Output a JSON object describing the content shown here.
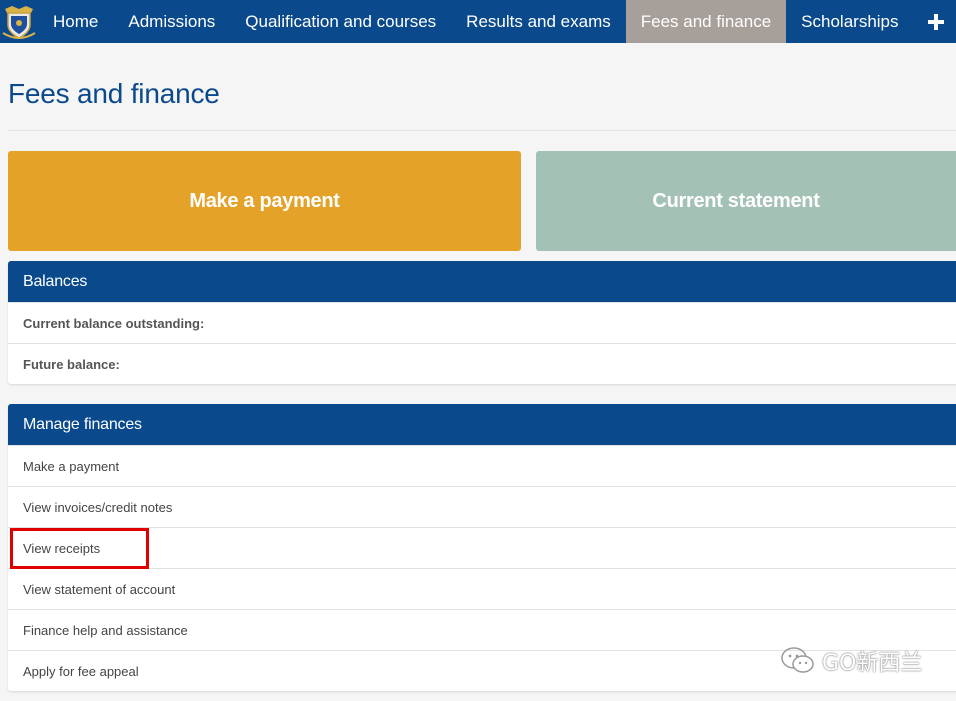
{
  "nav": {
    "items": [
      {
        "label": "Home",
        "active": false
      },
      {
        "label": "Admissions",
        "active": false
      },
      {
        "label": "Qualification and courses",
        "active": false
      },
      {
        "label": "Results and exams",
        "active": false
      },
      {
        "label": "Fees and finance",
        "active": true
      },
      {
        "label": "Scholarships",
        "active": false
      }
    ],
    "more_icon": "plus-icon",
    "logo_icon": "crest-logo"
  },
  "page": {
    "title": "Fees and finance"
  },
  "tiles": {
    "make_payment": "Make a payment",
    "current_statement": "Current statement"
  },
  "balances": {
    "heading": "Balances",
    "rows": [
      "Current balance outstanding:",
      "Future balance:"
    ]
  },
  "manage": {
    "heading": "Manage finances",
    "links": [
      "Make a payment",
      "View invoices/credit notes",
      "View receipts",
      "View statement of account",
      "Finance help and assistance",
      "Apply for fee appeal"
    ],
    "highlighted_index": 2
  },
  "watermark": {
    "text": "GO新西兰",
    "icon": "wechat-icon"
  },
  "colors": {
    "nav_bg": "#0a4a8c",
    "nav_active": "#a79f9a",
    "tile_pay": "#e4a228",
    "tile_statement": "#a4c1b6",
    "highlight": "#e00000"
  }
}
